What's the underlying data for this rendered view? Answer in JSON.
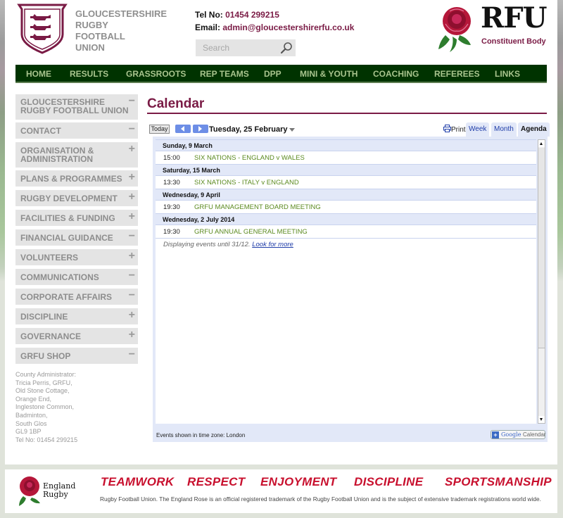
{
  "header": {
    "org_name_lines": [
      "GLOUCESTERSHIRE",
      "RUGBY",
      "FOOTBALL",
      "UNION"
    ],
    "tel_label": "Tel No:",
    "tel_value": "01454 299215",
    "email_label": "Email:",
    "email_value": "admin@gloucestershirerfu.co.uk",
    "search_placeholder": "Search",
    "rfu_text": "RFU",
    "rfu_sub": "Constituent Body"
  },
  "nav": {
    "items": [
      "HOME",
      "RESULTS",
      "GRASSROOTS",
      "REP TEAMS",
      "DPP",
      "MINI & YOUTH",
      "COACHING",
      "REFEREES",
      "LINKS"
    ]
  },
  "sidebar": {
    "items": [
      {
        "label_lines": [
          "GLOUCESTERSHIRE",
          "RUGBY FOOTBALL UNION"
        ],
        "toggle": "−"
      },
      {
        "label_lines": [
          "CONTACT"
        ],
        "toggle": "−"
      },
      {
        "label_lines": [
          "ORGANISATION &",
          "ADMINISTRATION"
        ],
        "toggle": "+"
      },
      {
        "label_lines": [
          "PLANS & PROGRAMMES"
        ],
        "toggle": "+"
      },
      {
        "label_lines": [
          "RUGBY DEVELOPMENT"
        ],
        "toggle": "+"
      },
      {
        "label_lines": [
          "FACILITIES & FUNDING"
        ],
        "toggle": "+"
      },
      {
        "label_lines": [
          "FINANCIAL GUIDANCE"
        ],
        "toggle": "−"
      },
      {
        "label_lines": [
          "VOLUNTEERS"
        ],
        "toggle": "+"
      },
      {
        "label_lines": [
          "COMMUNICATIONS"
        ],
        "toggle": "−"
      },
      {
        "label_lines": [
          "CORPORATE AFFAIRS"
        ],
        "toggle": "−"
      },
      {
        "label_lines": [
          "DISCIPLINE"
        ],
        "toggle": "+"
      },
      {
        "label_lines": [
          "GOVERNANCE"
        ],
        "toggle": "+"
      },
      {
        "label_lines": [
          "GRFU SHOP"
        ],
        "toggle": "−"
      }
    ],
    "address_lines": [
      "County Administrator:",
      "Tricia Perris, GRFU,",
      "Old Stone Cottage,",
      "Orange End,",
      "Inglestone Common,",
      "Badminton,",
      "South Glos",
      "GL9 1BP",
      "Tel No: 01454 299215"
    ]
  },
  "calendar": {
    "title": "Calendar",
    "today_label": "Today",
    "current_date": "Tuesday, 25 February",
    "print_label": "Print",
    "tabs": [
      {
        "label": "Week",
        "active": false
      },
      {
        "label": "Month",
        "active": false
      },
      {
        "label": "Agenda",
        "active": true
      }
    ],
    "days": [
      {
        "date": "Sunday, 9 March",
        "events": [
          {
            "time": "15:00",
            "title": "SIX NATIONS - ENGLAND v WALES"
          }
        ]
      },
      {
        "date": "Saturday, 15 March",
        "events": [
          {
            "time": "13:30",
            "title": "SIX NATIONS - ITALY v ENGLAND"
          }
        ]
      },
      {
        "date": "Wednesday, 9 April",
        "events": [
          {
            "time": "19:30",
            "title": "GRFU MANAGEMENT BOARD MEETING"
          }
        ]
      },
      {
        "date": "Wednesday, 2 July 2014",
        "events": [
          {
            "time": "19:30",
            "title": "GRFU ANNUAL GENERAL MEETING"
          }
        ]
      }
    ],
    "displaying_text": "Displaying events until 31/12.",
    "look_more_label": "Look for more",
    "timezone_text": "Events shown in time zone: London",
    "gcal_google": "Google",
    "gcal_calendar": "Calendar"
  },
  "footer": {
    "england_line1": "England",
    "england_line2": "Rugby",
    "values": [
      "TEAMWORK",
      "RESPECT",
      "ENJOYMENT",
      "DISCIPLINE",
      "SPORTSMANSHIP"
    ],
    "trademark": "Rugby Football Union. The England Rose is an official registered trademark of the Rugby Football Union and is the subject of extensive trademark registrations world wide.",
    "value_color": "#c8102e"
  },
  "colors": {
    "brand_maroon": "#7a1b45",
    "nav_bg": "#003300",
    "nav_text": "#a9c48e",
    "event_green": "#5b8a1f"
  }
}
